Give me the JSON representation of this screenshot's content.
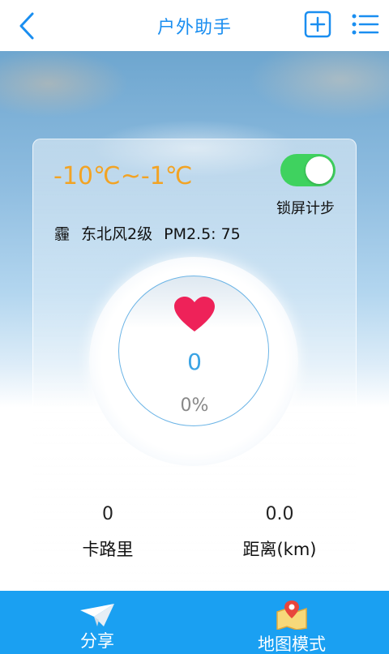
{
  "header": {
    "title": "户外助手",
    "icons": {
      "back": "chevron-left-icon",
      "add": "plus-square-icon",
      "menu": "list-menu-icon"
    }
  },
  "weather": {
    "temperature_range": "-10℃~-1℃",
    "condition": "霾",
    "wind": "东北风2级",
    "pm_label": "PM2.5:",
    "pm_value": "75"
  },
  "lock_screen_step": {
    "label": "锁屏计步",
    "enabled": true
  },
  "ring": {
    "icon": "heart-icon",
    "steps": "0",
    "progress_text": "0%",
    "progress": 0
  },
  "stats": {
    "calories_value": "0",
    "calories_label": "卡路里",
    "distance_value": "0.0",
    "distance_label": "距离(km)"
  },
  "bottom_nav": {
    "share_label": "分享",
    "map_label": "地图模式"
  },
  "colors": {
    "accent": "#1a8ef0",
    "temperature": "#f2a324",
    "toggle_on": "#3fd25f",
    "heart": "#ee2259",
    "steps": "#3aa3e4",
    "bottom_bar": "#1aa0f2"
  }
}
